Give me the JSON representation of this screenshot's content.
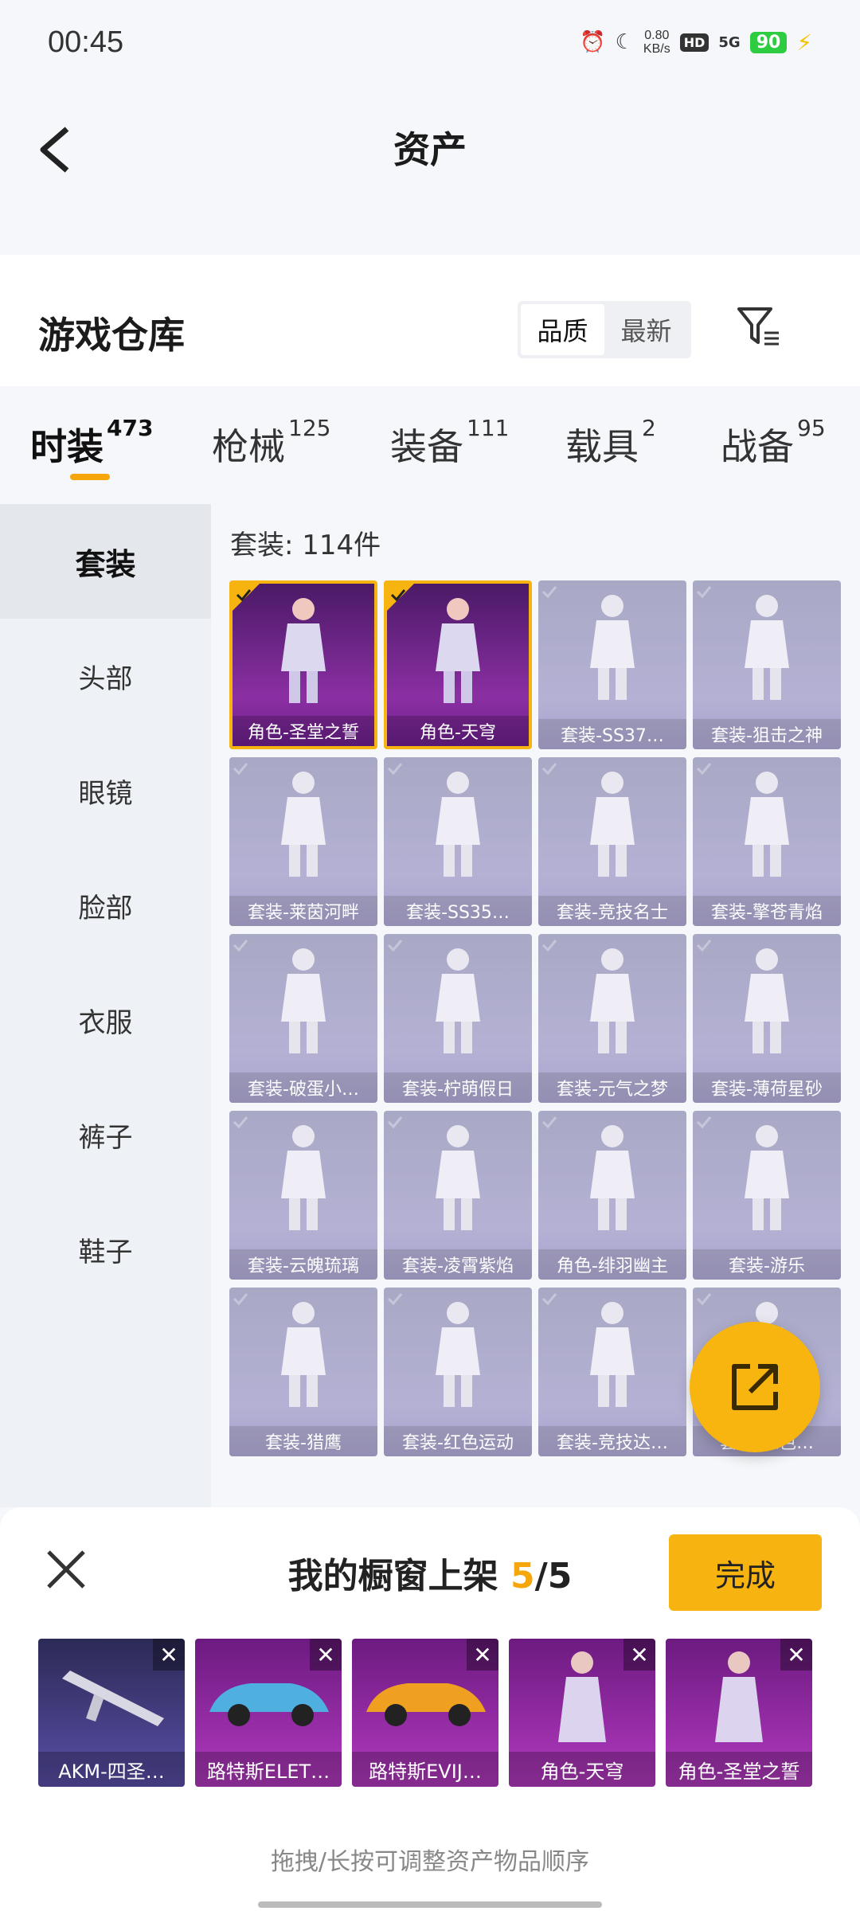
{
  "status": {
    "time": "00:45",
    "net_speed_value": "0.80",
    "net_speed_unit": "KB/s",
    "hd": "HD",
    "signal": "5G",
    "battery": "90"
  },
  "header": {
    "title": "资产"
  },
  "warehouse": {
    "title": "游戏仓库",
    "sort_options": [
      "品质",
      "最新"
    ],
    "selected_sort": "品质"
  },
  "tabs": [
    {
      "label": "时装",
      "count": "473"
    },
    {
      "label": "枪械",
      "count": "125"
    },
    {
      "label": "装备",
      "count": "111"
    },
    {
      "label": "载具",
      "count": "2"
    },
    {
      "label": "战备",
      "count": "95"
    }
  ],
  "sidebar": [
    "套装",
    "头部",
    "眼镜",
    "脸部",
    "衣服",
    "裤子",
    "鞋子"
  ],
  "list": {
    "count_label": "套装: 114件",
    "items": [
      "角色-圣堂之誓",
      "角色-天穹",
      "套装-SS37…",
      "套装-狙击之神",
      "套装-莱茵河畔",
      "套装-SS35…",
      "套装-竞技名士",
      "套装-擎苍青焰",
      "套装-破蛋小…",
      "套装-柠萌假日",
      "套装-元气之梦",
      "套装-薄荷星砂",
      "套装-云魄琉璃",
      "套装-凌霄紫焰",
      "角色-绯羽幽主",
      "套装-游乐",
      "套装-猎鹰",
      "套装-红色运动",
      "套装-竞技达…",
      "套装-红色…"
    ]
  },
  "showcase": {
    "title_prefix": "我的橱窗上架 ",
    "current": "5",
    "sep_total": "/5",
    "done_label": "完成",
    "items": [
      "AKM-四圣…",
      "路特斯ELET…",
      "路特斯EVIJ…",
      "角色-天穹",
      "角色-圣堂之誓"
    ],
    "hint": "拖拽/长按可调整资产物品顺序"
  }
}
